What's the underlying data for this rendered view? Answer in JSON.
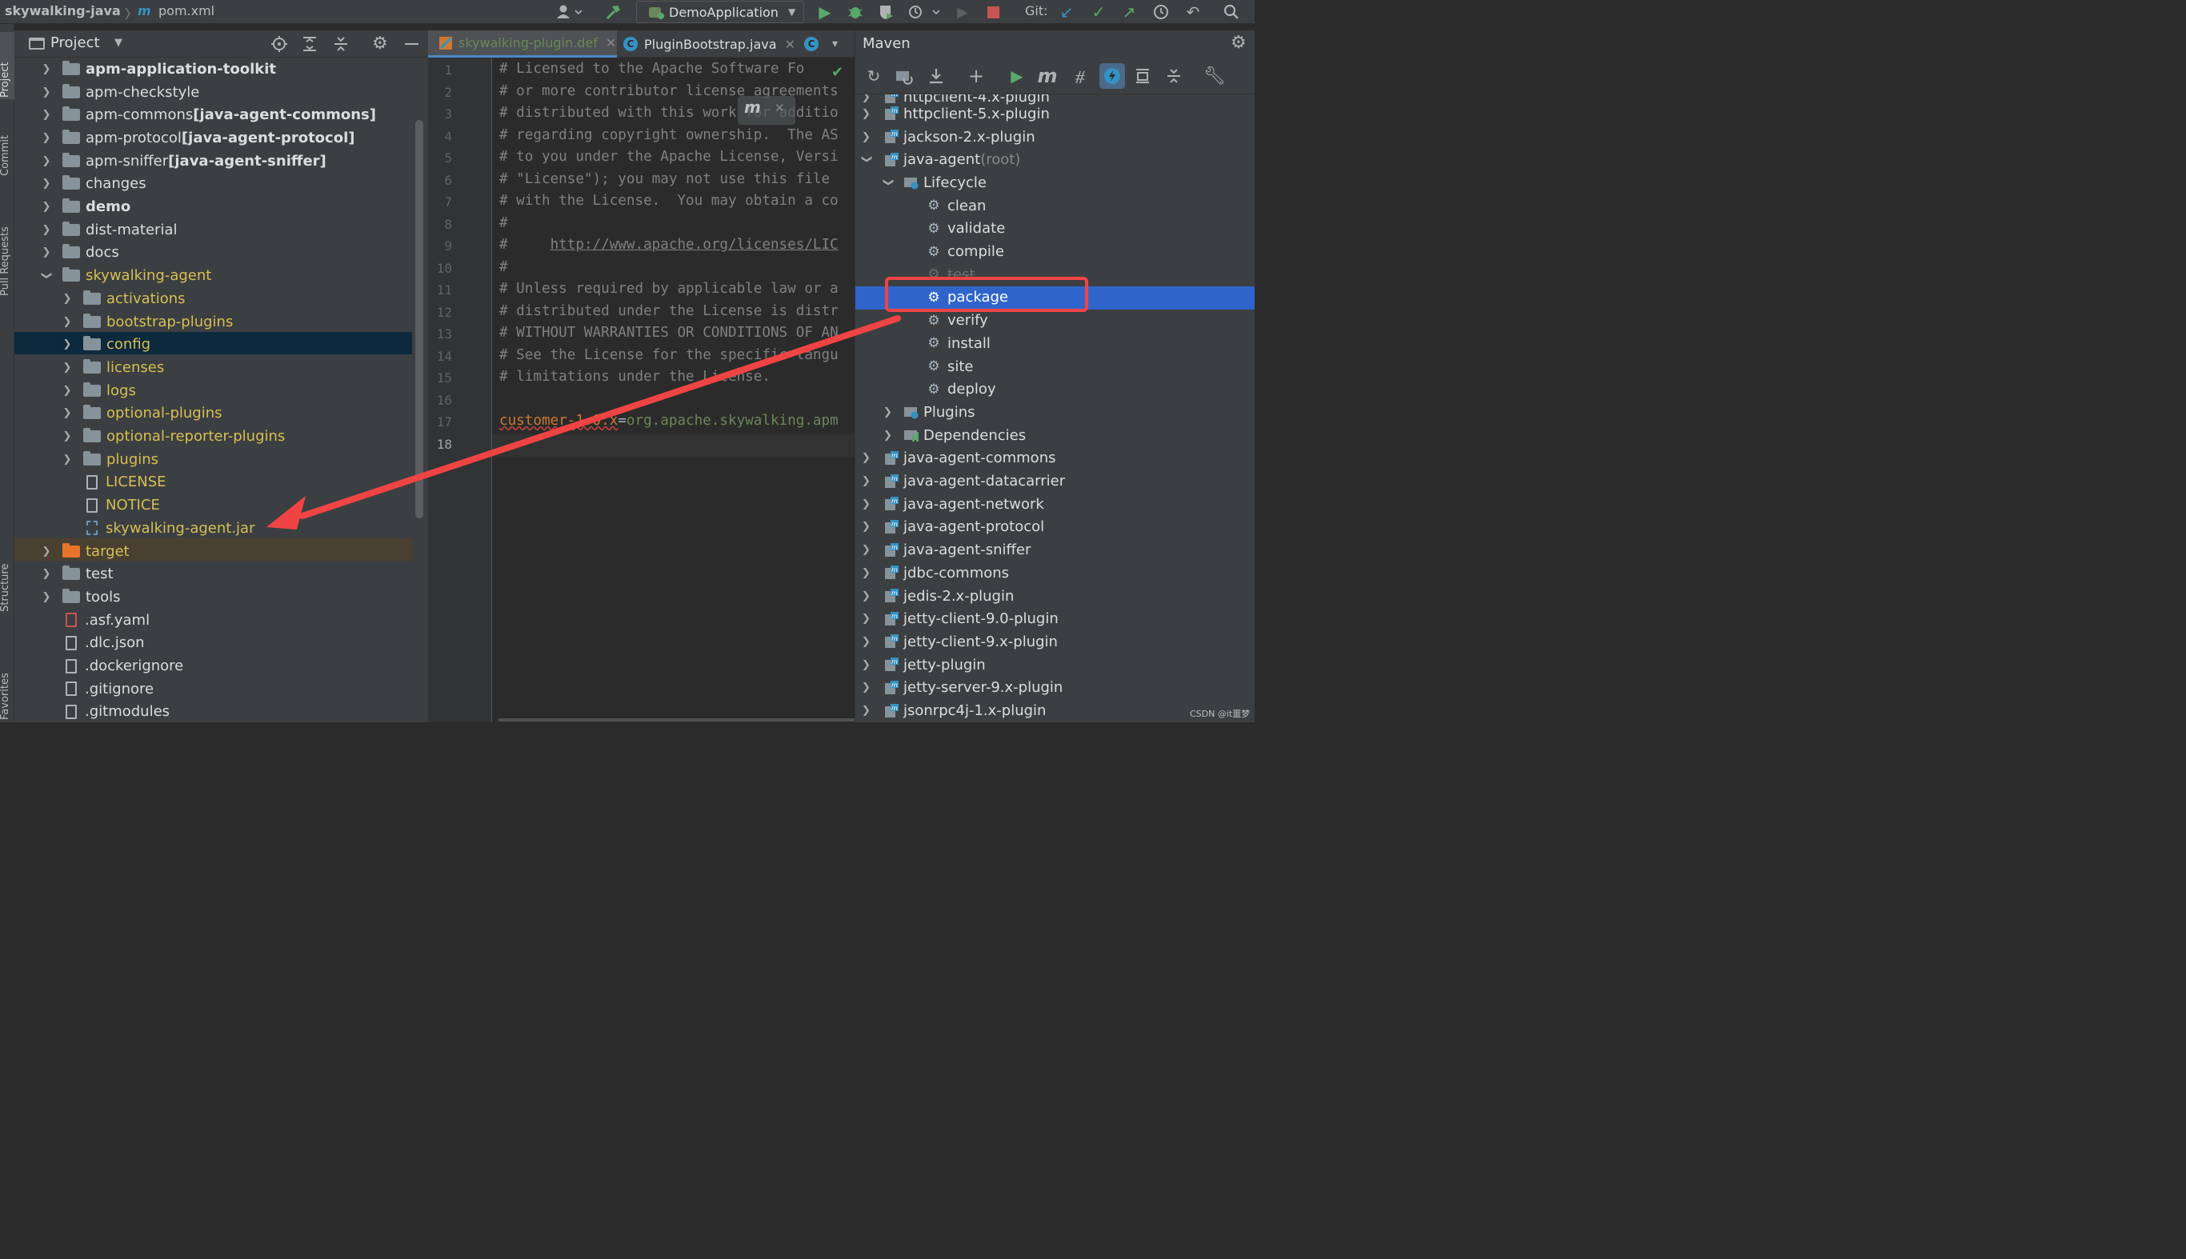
{
  "topbar": {
    "project": "skywalking-java",
    "separator": "〉",
    "file_icon": "m",
    "file": "pom.xml",
    "run_config": "DemoApplication",
    "git_label": "Git:"
  },
  "left_strip": [
    "Project",
    "Commit",
    "Pull Requests",
    "Structure",
    "Favorites"
  ],
  "project_panel": {
    "title": "Project",
    "tree": [
      {
        "label": "apm-application-toolkit",
        "suffix": "",
        "bold": true
      },
      {
        "label": "apm-checkstyle",
        "suffix": ""
      },
      {
        "label": "apm-commons ",
        "suffix": "[java-agent-commons]"
      },
      {
        "label": "apm-protocol ",
        "suffix": "[java-agent-protocol]"
      },
      {
        "label": "apm-sniffer ",
        "suffix": "[java-agent-sniffer]"
      },
      {
        "label": "changes",
        "suffix": ""
      },
      {
        "label": "demo",
        "suffix": "",
        "bold": true
      },
      {
        "label": "dist-material",
        "suffix": ""
      },
      {
        "label": "docs",
        "suffix": ""
      },
      {
        "label": "skywalking-agent",
        "suffix": ""
      },
      {
        "label": "activations",
        "suffix": ""
      },
      {
        "label": "bootstrap-plugins",
        "suffix": ""
      },
      {
        "label": "config",
        "suffix": ""
      },
      {
        "label": "licenses",
        "suffix": ""
      },
      {
        "label": "logs",
        "suffix": ""
      },
      {
        "label": "optional-plugins",
        "suffix": ""
      },
      {
        "label": "optional-reporter-plugins",
        "suffix": ""
      },
      {
        "label": "plugins",
        "suffix": ""
      },
      {
        "label": "LICENSE",
        "suffix": ""
      },
      {
        "label": "NOTICE",
        "suffix": ""
      },
      {
        "label": "skywalking-agent.jar",
        "suffix": ""
      },
      {
        "label": "target",
        "suffix": ""
      },
      {
        "label": "test",
        "suffix": ""
      },
      {
        "label": "tools",
        "suffix": ""
      },
      {
        "label": ".asf.yaml",
        "suffix": ""
      },
      {
        "label": ".dlc.json",
        "suffix": ""
      },
      {
        "label": ".dockerignore",
        "suffix": ""
      },
      {
        "label": ".gitignore",
        "suffix": ""
      },
      {
        "label": ".gitmodules",
        "suffix": ""
      }
    ]
  },
  "editor": {
    "tabs": [
      "skywalking-plugin.def",
      "PluginBootstrap.java"
    ],
    "popup_icon": "m",
    "lines": [
      "# Licensed to the Apache Software Fo",
      "# or more contributor license agreements",
      "# distributed with this work for additio",
      "# regarding copyright ownership.  The AS",
      "# to you under the Apache License, Versi",
      "# \"License\"); you may not use this file",
      "# with the License.  You may obtain a co",
      "#",
      "#     http://www.apache.org/licenses/LIC",
      "#",
      "# Unless required by applicable law or a",
      "# distributed under the License is distr",
      "# WITHOUT WARRANTIES OR CONDITIONS OF AN",
      "# See the License for the specific langu",
      "# limitations under the License.",
      "",
      "customer-1.0.x=org.apache.skywalking.apm",
      ""
    ],
    "line_numbers": [
      "1",
      "2",
      "3",
      "4",
      "5",
      "6",
      "7",
      "8",
      "9",
      "10",
      "11",
      "12",
      "13",
      "14",
      "15",
      "16",
      "17",
      "18"
    ],
    "current_line": 18,
    "last_line_key": "customer-1.0.x",
    "last_line_eq": "=",
    "last_line_value": "org.apache.skywalking.apm"
  },
  "maven": {
    "title": "Maven",
    "tree": [
      {
        "label": "httpclient-4.x-plugin",
        "suffix": ""
      },
      {
        "label": "httpclient-5.x-plugin",
        "suffix": ""
      },
      {
        "label": "jackson-2.x-plugin",
        "suffix": ""
      },
      {
        "label": "java-agent",
        "suffix": " (root)"
      },
      {
        "label": "Lifecycle",
        "suffix": ""
      },
      {
        "label": "clean",
        "suffix": ""
      },
      {
        "label": "validate",
        "suffix": ""
      },
      {
        "label": "compile",
        "suffix": ""
      },
      {
        "label": "test",
        "suffix": ""
      },
      {
        "label": "package",
        "suffix": ""
      },
      {
        "label": "verify",
        "suffix": ""
      },
      {
        "label": "install",
        "suffix": ""
      },
      {
        "label": "site",
        "suffix": ""
      },
      {
        "label": "deploy",
        "suffix": ""
      },
      {
        "label": "Plugins",
        "suffix": ""
      },
      {
        "label": "Dependencies",
        "suffix": ""
      },
      {
        "label": "java-agent-commons",
        "suffix": ""
      },
      {
        "label": "java-agent-datacarrier",
        "suffix": ""
      },
      {
        "label": "java-agent-network",
        "suffix": ""
      },
      {
        "label": "java-agent-protocol",
        "suffix": ""
      },
      {
        "label": "java-agent-sniffer",
        "suffix": ""
      },
      {
        "label": "jdbc-commons",
        "suffix": ""
      },
      {
        "label": "jedis-2.x-plugin",
        "suffix": ""
      },
      {
        "label": "jetty-client-9.0-plugin",
        "suffix": ""
      },
      {
        "label": "jetty-client-9.x-plugin",
        "suffix": ""
      },
      {
        "label": "jetty-plugin",
        "suffix": ""
      },
      {
        "label": "jetty-server-9.x-plugin",
        "suffix": ""
      },
      {
        "label": "jsonrpc4j-1.x-plugin",
        "suffix": ""
      }
    ]
  },
  "watermark": "CSDN @it噩梦",
  "colors": {
    "selection_blue": "#2f65ca",
    "tree_selection": "#0d293e",
    "annotation_red": "#f04444",
    "folder_yellow": "#d6bf55",
    "target_orange": "#e8742c",
    "target_row": "#4a4032"
  }
}
